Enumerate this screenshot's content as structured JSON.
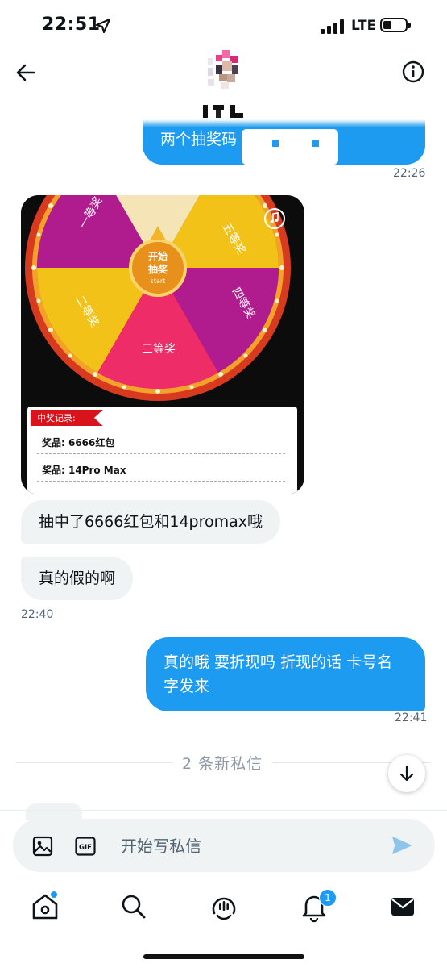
{
  "status_bar": {
    "time": "22:51",
    "network": "LTE"
  },
  "messages": [
    {
      "id": "m1",
      "direction": "outgoing",
      "text": "两个抽奖码",
      "time": "22:26"
    },
    {
      "id": "m_img",
      "direction": "incoming",
      "type": "image",
      "wheel_labels": [
        "一等奖",
        "二等奖",
        "三等奖",
        "四等奖",
        "五等奖"
      ],
      "center_label": [
        "开始",
        "抽奖",
        "start"
      ],
      "record_title": "中奖记录:",
      "records": [
        "奖品: 6666红包",
        "奖品: 14Pro Max"
      ]
    },
    {
      "id": "m2",
      "direction": "incoming",
      "text": "抽中了6666红包和14promax哦"
    },
    {
      "id": "m3",
      "direction": "incoming",
      "text": "真的假的啊",
      "time": "22:40"
    },
    {
      "id": "m4",
      "direction": "outgoing",
      "text": "真的哦 要折现吗 折现的话 卡号名字发来",
      "time": "22:41"
    }
  ],
  "new_messages_divider": "2 条新私信",
  "composer": {
    "placeholder": "开始写私信"
  },
  "tab_bar": {
    "notifications_badge": "1"
  },
  "colors": {
    "accent": "#1d9bf0",
    "incoming_bubble": "#eff3f4"
  }
}
